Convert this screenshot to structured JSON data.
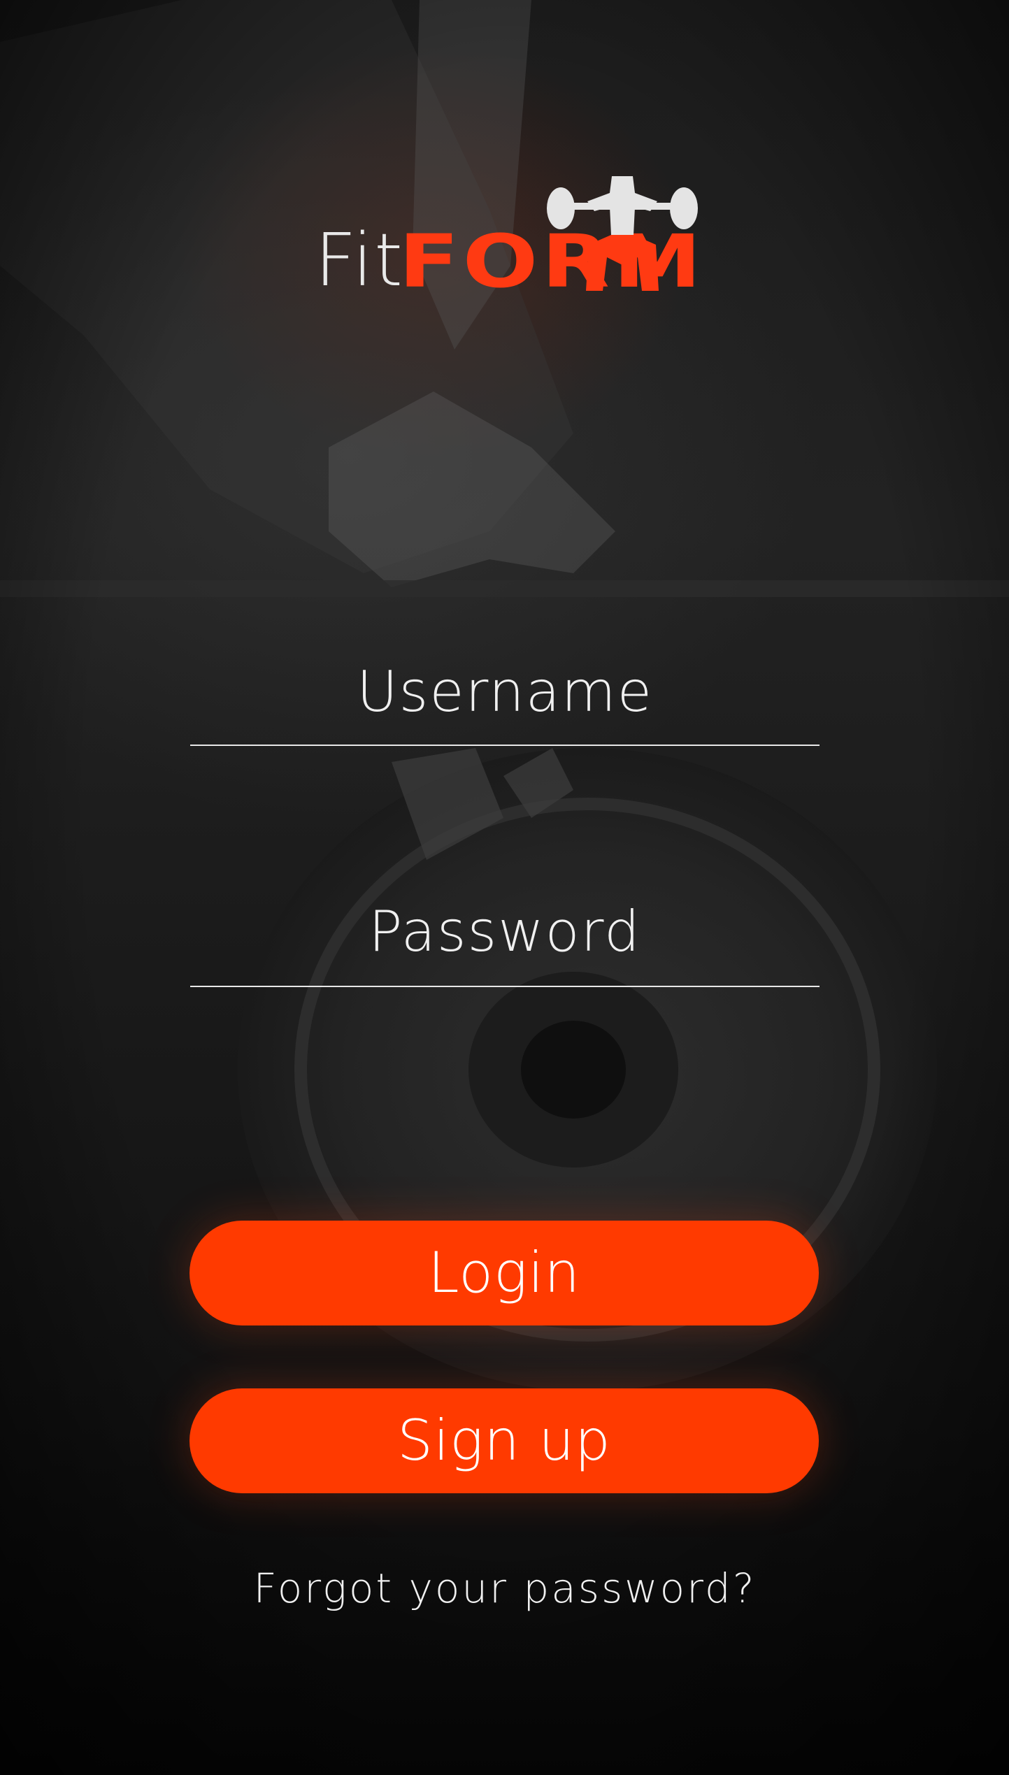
{
  "app": {
    "logo": {
      "part_light": "Fit",
      "part_bold": "FORM",
      "icon": "weightlifter-icon"
    }
  },
  "login_form": {
    "username": {
      "value": "",
      "placeholder": "Username"
    },
    "password": {
      "value": "",
      "placeholder": "Password"
    },
    "login_label": "Login",
    "signup_label": "Sign up",
    "forgot_label": "Forgot your password?"
  },
  "colors": {
    "accent": "#ff3a00",
    "logo_orange": "#ff3a12",
    "text": "#f0f0f0",
    "background": "#1a1a1a"
  }
}
